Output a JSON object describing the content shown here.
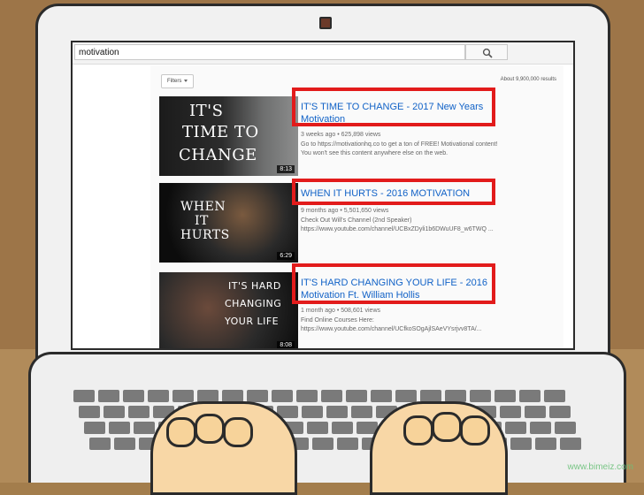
{
  "search": {
    "query": "motivation"
  },
  "toolbar": {
    "filters_label": "Filters"
  },
  "results_meta": {
    "count_text": "About 9,900,000 results"
  },
  "results": [
    {
      "title_line1": "IT'S TIME TO CHANGE - 2017 New Years",
      "title_line2": "Motivation",
      "meta": "3 weeks ago  •  625,898 views",
      "desc_line1": "Go to https://motivationhq.co to get a ton of FREE! Motivational content!",
      "desc_line2": "You won't see this content anywhere else on the web.",
      "duration": "8:13",
      "thumb_text_1": "IT'S",
      "thumb_text_2": "TIME TO",
      "thumb_text_3": "CHANGE"
    },
    {
      "title_line1": "WHEN IT HURTS - 2016 MOTIVATION",
      "title_line2": "",
      "meta": "9 months ago  •  5,501,650 views",
      "desc_line1": "Check Out Will's Channel (2nd Speaker)",
      "desc_line2": "https://www.youtube.com/channel/UCBxZDyli1b6DWuUF8_w6TWQ ...",
      "duration": "6:29",
      "thumb_text_1": "WHEN",
      "thumb_text_2": "IT",
      "thumb_text_3": "HURTS"
    },
    {
      "title_line1": "IT'S HARD CHANGING YOUR LIFE - 2016",
      "title_line2": "Motivation Ft. William Hollis",
      "meta": "1 month ago  •  508,601 views",
      "desc_line1": "Find Online Courses Here:",
      "desc_line2": "https://www.youtube.com/channel/UCfkoSOgAjlSAeVYsrjvv8TA/...",
      "duration": "8:08",
      "thumb_text_1": "IT'S HARD",
      "thumb_text_2": "CHANGING",
      "thumb_text_3": "YOUR LIFE"
    }
  ],
  "watermark": {
    "text": "www.bimeiz.com"
  },
  "colors": {
    "highlight": "#e21b1b",
    "link_blue": "#1162c7"
  }
}
